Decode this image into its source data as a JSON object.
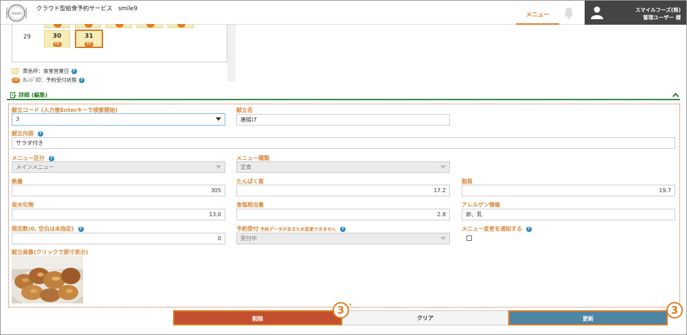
{
  "header": {
    "app_title": "クラウド型給食予約サービス　smile9",
    "menu_tab": "メニュー",
    "company": "スマイルフーズ(株)",
    "user_role": "管理ユーザー 様"
  },
  "calendar": {
    "week_number": "29",
    "days": [
      {
        "day": "30",
        "badge": "3件",
        "selected": false
      },
      {
        "day": "31",
        "badge": "3件",
        "selected": true
      }
    ]
  },
  "legend": {
    "yellow_frame": "黄色枠：食堂営業日",
    "orange_mark_badge": "3件",
    "orange_mark": "ｵﾚﾝｼﾞ印：予約受付状態"
  },
  "section": {
    "title": "詳細 (編集)"
  },
  "form": {
    "menu_code_label": "献立コード (入力後Enterキーで検索開始)",
    "menu_code_value": "3",
    "menu_name_label": "献立名",
    "menu_name_value": "唐揚げ",
    "content_label": "献立内容",
    "content_value": "サラダ付き",
    "menu_category_label": "メニュー区分",
    "menu_category_value": "メインメニュー",
    "menu_type_label": "メニュー種類",
    "menu_type_value": "定食",
    "calories_label": "熱量",
    "calories_value": "305",
    "protein_label": "たんぱく質",
    "protein_value": "17.2",
    "fat_label": "脂質",
    "fat_value": "19.7",
    "carbs_label": "炭水化物",
    "carbs_value": "13.0",
    "salt_label": "食塩相当量",
    "salt_value": "2.8",
    "allergen_label": "アレルゲン情報",
    "allergen_value": "卵、乳",
    "limit_label": "限定数(0, 空白は未指定)",
    "limit_value": "0",
    "reservation_label": "予約受付",
    "reservation_note": "予約データがあるため変更できません",
    "reservation_value": "受付中",
    "notify_label": "メニュー変更を通知する",
    "image_label": "献立画像(クリックで原寸表示)"
  },
  "buttons": {
    "delete": "削除",
    "clear": "クリア",
    "update": "更新"
  },
  "markers": {
    "delete_marker": "3",
    "delete_marker_prime": "'",
    "update_marker": "3"
  },
  "help_mark": "?",
  "colors": {
    "accent": "#e07a1f",
    "delete": "#c3502e",
    "update": "#4d86a3",
    "section_green": "#2e8b3c",
    "label": "#d6883c"
  }
}
